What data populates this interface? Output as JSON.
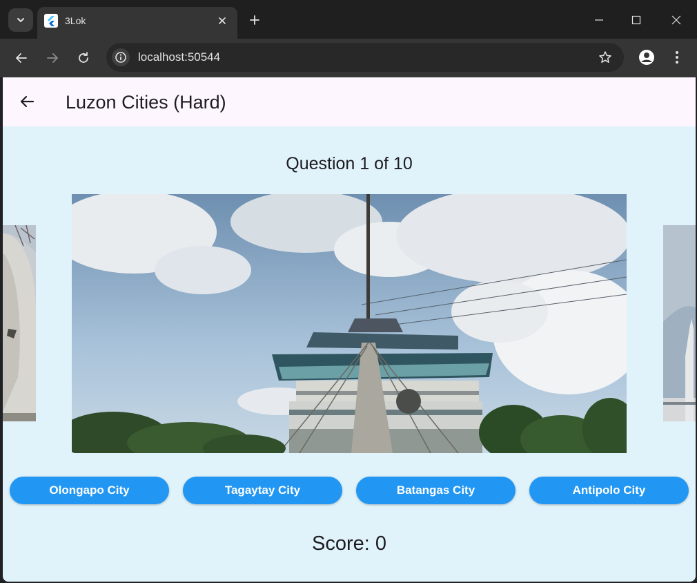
{
  "browser": {
    "tab_title": "3Lok",
    "url": "localhost:50544",
    "icons": {
      "tab_search": "chevron-down-icon",
      "tab_close": "close-icon",
      "new_tab": "plus-icon",
      "minimize": "minimize-icon",
      "maximize": "maximize-icon",
      "window_close": "close-icon",
      "back": "arrow-left-icon",
      "forward": "arrow-right-icon",
      "reload": "reload-icon",
      "site_info": "info-icon",
      "bookmark": "star-icon",
      "profile": "account-icon",
      "menu": "more-vert-icon"
    }
  },
  "app": {
    "title": "Luzon Cities (Hard)",
    "back_icon": "arrow-left-icon",
    "question_label": "Question 1 of 10",
    "answers": [
      {
        "label": "Olongapo City"
      },
      {
        "label": "Tagaytay City"
      },
      {
        "label": "Batangas City"
      },
      {
        "label": "Antipolo City"
      }
    ],
    "score_label": "Score: 0"
  },
  "colors": {
    "app_background": "#e0f3fb",
    "appbar_background": "#fdf6ff",
    "button_primary": "#2196f3",
    "button_text": "#ffffff",
    "chrome_dark": "#1f1f1f",
    "chrome_toolbar": "#353535"
  }
}
